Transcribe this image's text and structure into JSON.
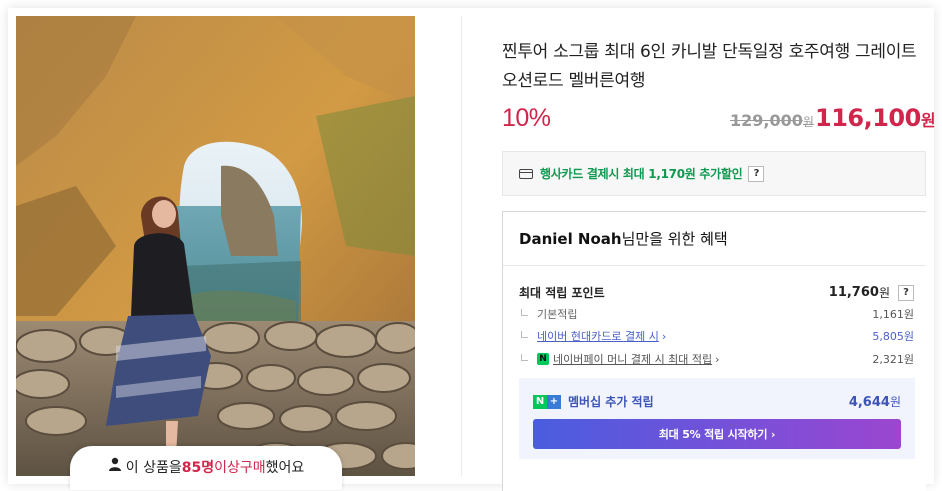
{
  "product": {
    "title": "찐투어 소그룹 최대 6인 카니발 단독일정 호주여행 그레이트오션로드 멜버른여행",
    "discount": "10%",
    "original_price": "129,000",
    "original_price_unit": "원",
    "sale_price": "116,100",
    "sale_price_unit": "원"
  },
  "photo": {
    "buyers_prefix": "이 상품을 ",
    "buyers_count": "85명",
    "buyers_mid": " 이상 ",
    "buyers_highlight": "구매",
    "buyers_suffix": " 했어요"
  },
  "card_promo": {
    "text": "행사카드 결제시 최대 1,170원 추가할인",
    "help": "?"
  },
  "benefit": {
    "user_name": "Daniel Noah",
    "heading_suffix": "님만을 위한 혜택",
    "max_points_label": "최대 적립 포인트",
    "max_points_value": "11,760",
    "max_points_unit": "원",
    "help": "?",
    "items": [
      {
        "label": "기본적립",
        "value": "1,161원"
      },
      {
        "label": "네이버 현대카드로 결제 시",
        "value": "5,805원"
      },
      {
        "label": "네이버페이 머니 결제 시 최대 적립",
        "value": "2,321원"
      }
    ],
    "membership": {
      "label": "멤버십 추가 적립",
      "value": "4,644",
      "unit": "원",
      "cta": "최대 5% 적립 시작하기 ›"
    }
  },
  "colors": {
    "accent_red": "#d0264b",
    "promo_green": "#0e9a50",
    "link_blue": "#4a5fc8",
    "membership_bg": "#f2f4fd"
  }
}
